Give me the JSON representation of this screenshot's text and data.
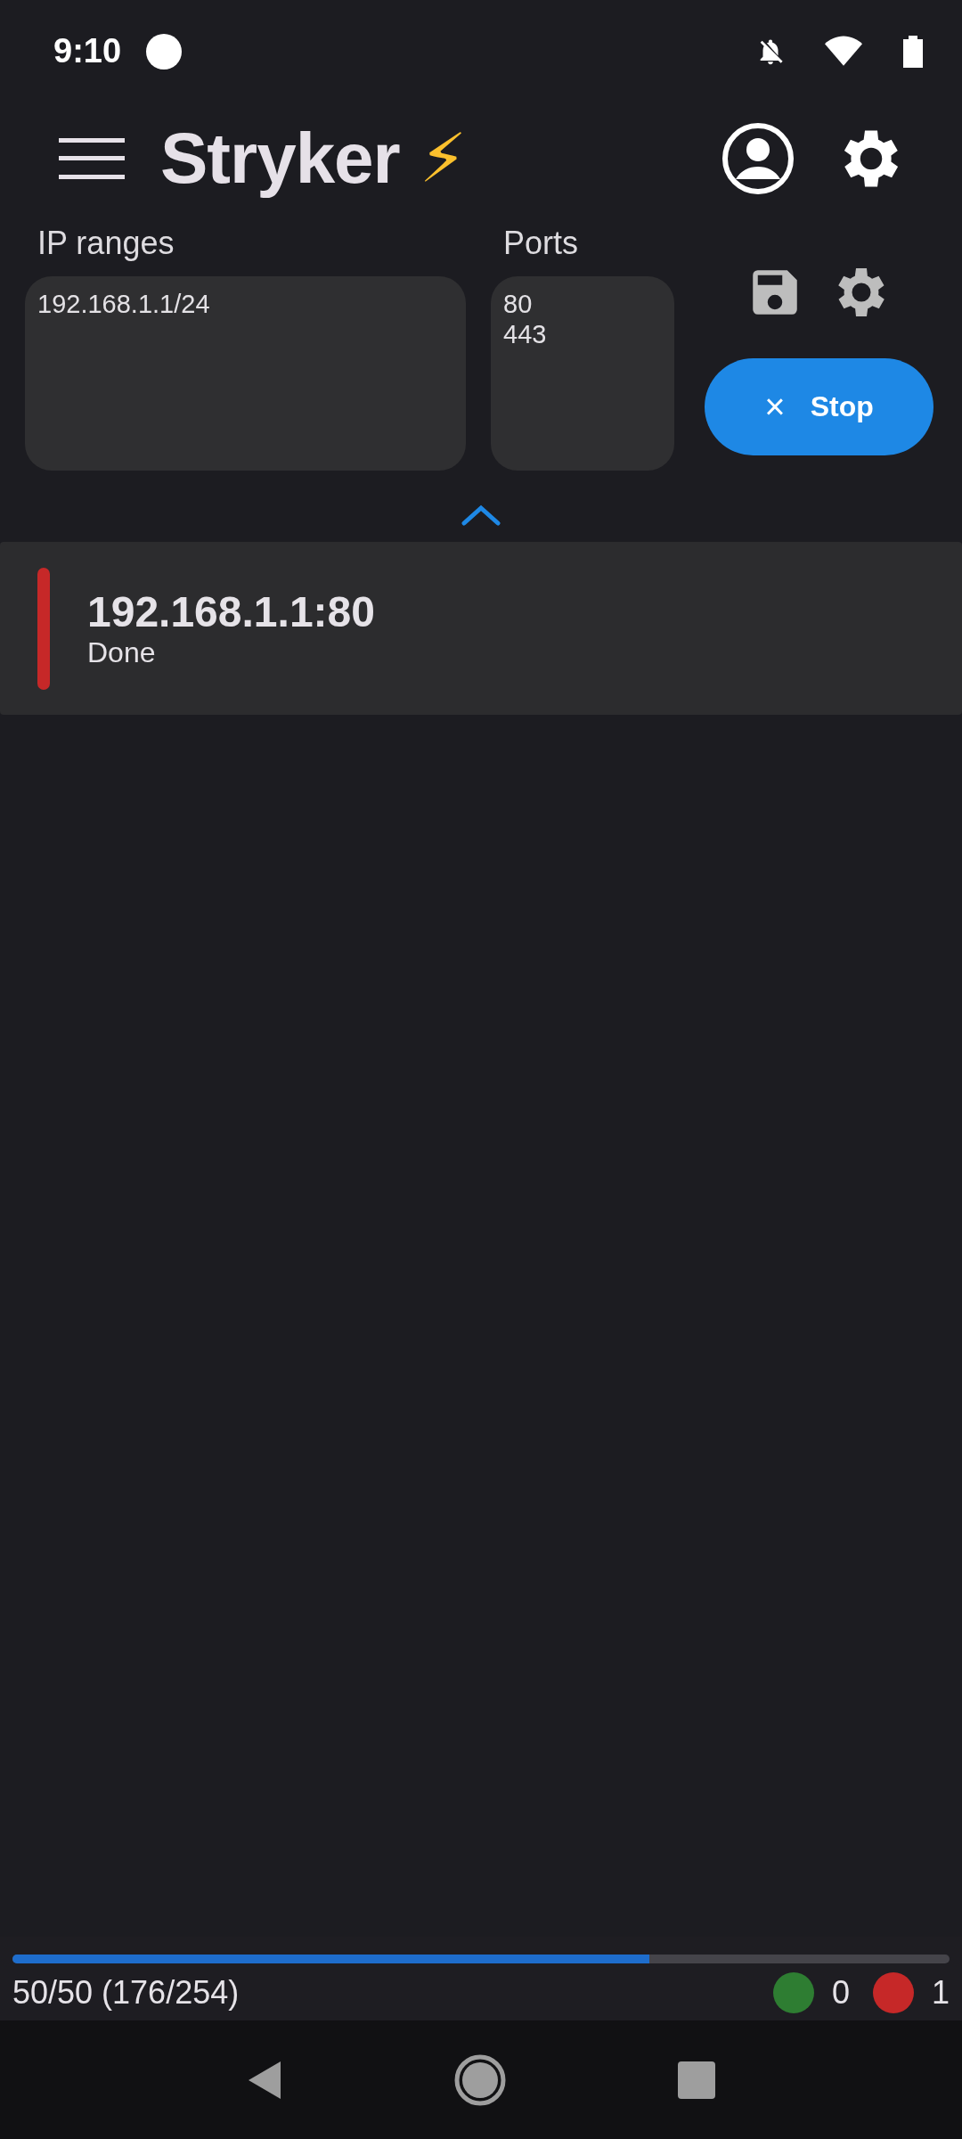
{
  "status_bar": {
    "time": "9:10"
  },
  "app_bar": {
    "title": "Stryker",
    "emoji": "⚡"
  },
  "ip_ranges": {
    "label": "IP ranges",
    "value": "192.168.1.1/24"
  },
  "ports": {
    "label": "Ports",
    "value": "80\n443"
  },
  "stop_button": {
    "label": "Stop",
    "icon": "×"
  },
  "results": [
    {
      "address": "192.168.1.1:80",
      "status": "Done",
      "color": "#c62828"
    }
  ],
  "progress": {
    "level": 0.68,
    "text": "50/50 (176/254)"
  },
  "counters": [
    {
      "count": "0",
      "color": "#2e7d32"
    },
    {
      "count": "1",
      "color": "#c62828"
    }
  ]
}
